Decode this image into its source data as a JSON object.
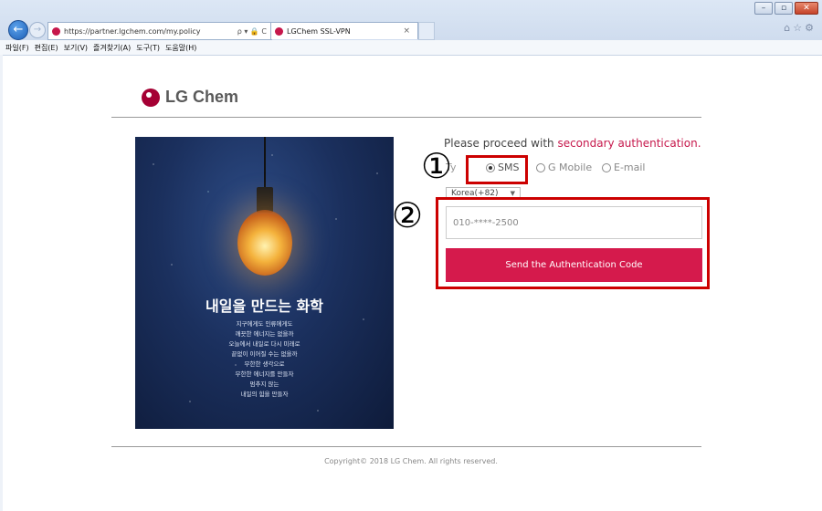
{
  "browser": {
    "url": "https://partner.lgchem.com/my.policy",
    "url_controls": "ρ ▾ 🔒 C",
    "tab_title": "LGChem SSL-VPN",
    "tab_close": "×",
    "menu": [
      "파일(F)",
      "편집(E)",
      "보기(V)",
      "즐겨찾기(A)",
      "도구(T)",
      "도움말(H)"
    ],
    "right_icons": "⌂☆⚙"
  },
  "logo": {
    "text": "LG Chem",
    "color": "#a50034"
  },
  "poster": {
    "title": "내일을 만드는 화학",
    "lines": [
      "지구에게도 인류에게도",
      "깨끗한 에너지는 없을까",
      "오늘에서 내일로 다시 미래로",
      "끝없이 이어질 수는 없을까",
      "무한한 생각으로",
      "무한한 에너지를 만들자",
      "멈추지 않는",
      "내일의 힘을 만들자"
    ]
  },
  "auth": {
    "heading_prefix": "Please proceed with ",
    "heading_accent": "secondary authentication.",
    "type_label": "Ty",
    "options": [
      "SMS",
      "G Mobile",
      "E-mail"
    ],
    "selected": "SMS",
    "country": "Korea(+82)",
    "phone_value": "010-****-2500",
    "send_label": "Send the Authentication Code",
    "accent_color": "#d51a4c"
  },
  "annotations": {
    "one": "①",
    "two": "②",
    "color": "#cc0000"
  },
  "footer": {
    "copyright": "Copyright© 2018 LG Chem. All rights reserved."
  }
}
